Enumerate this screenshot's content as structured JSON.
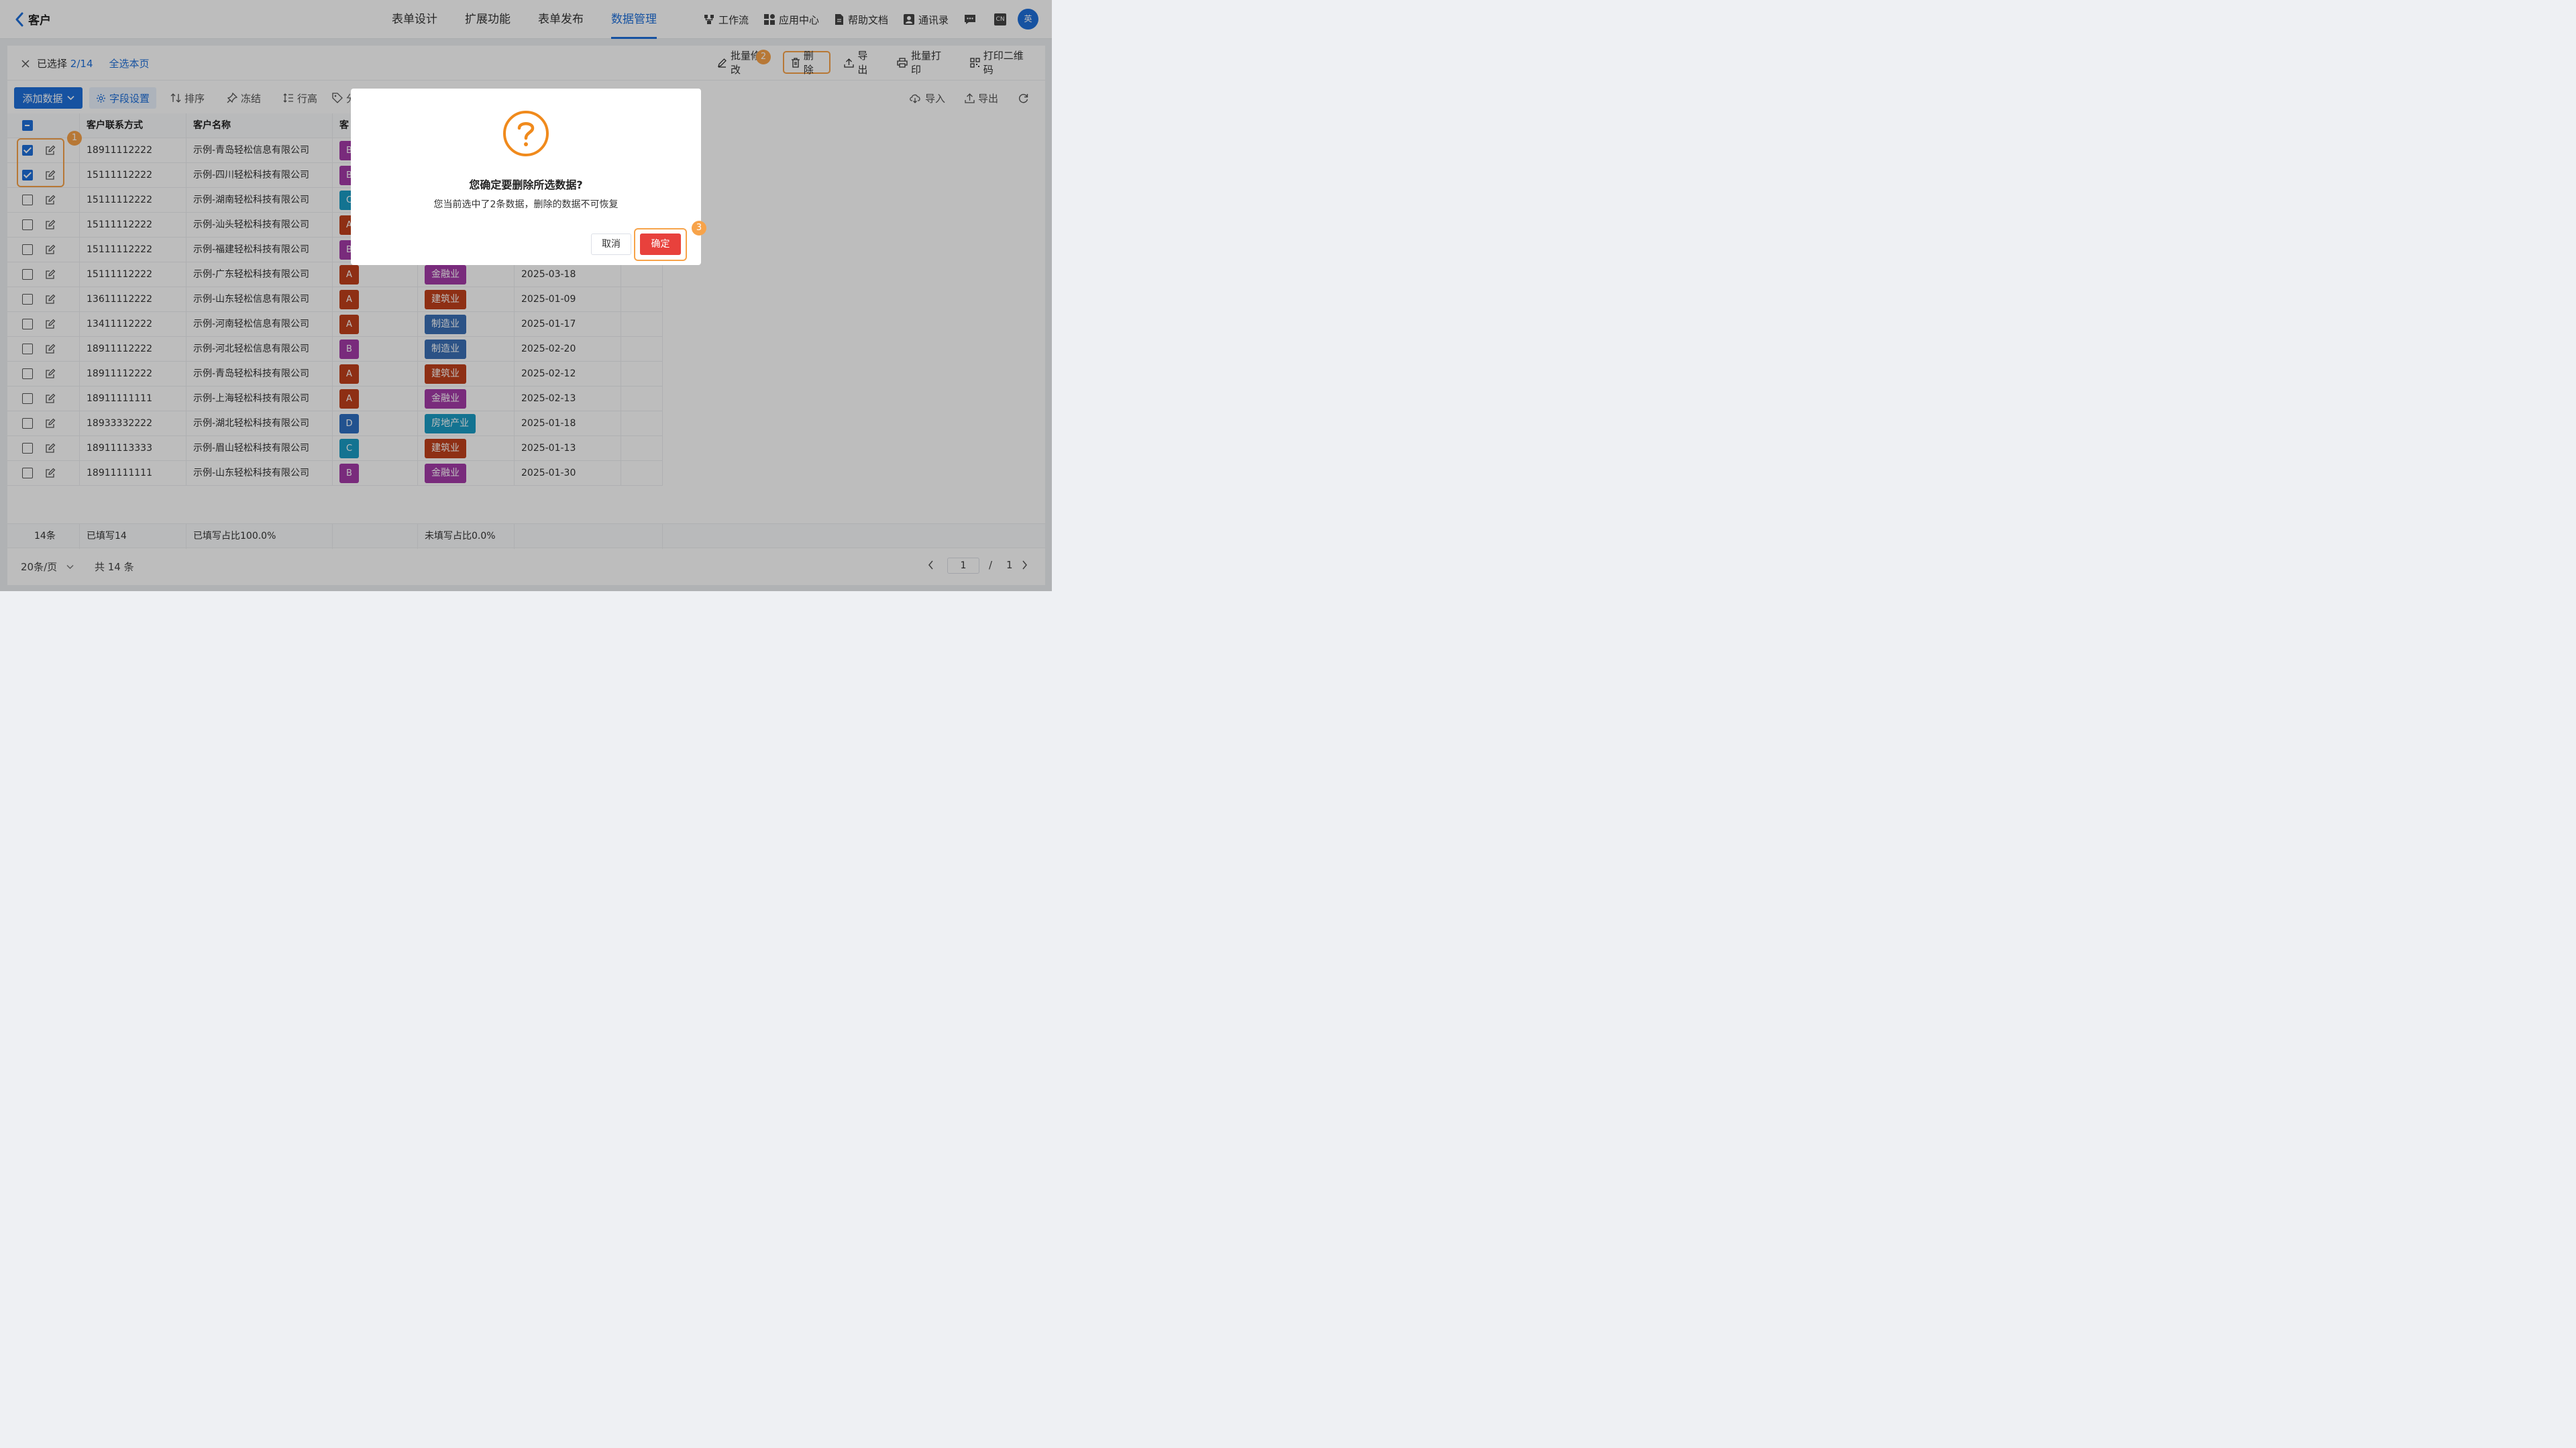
{
  "header": {
    "back_label": "客户",
    "tabs": [
      "表单设计",
      "扩展功能",
      "表单发布",
      "数据管理"
    ],
    "active_tab": "数据管理",
    "tools": [
      "工作流",
      "应用中心",
      "帮助文档",
      "通讯录"
    ],
    "lang_badge": "CN",
    "avatar": "英"
  },
  "selection": {
    "label": "已选择",
    "count": "2/14",
    "select_page": "全选本页",
    "actions": [
      "批量修改",
      "删除",
      "导出",
      "批量打印",
      "打印二维码"
    ]
  },
  "toolbar": {
    "add_label": "添加数据",
    "field_settings": "字段设置",
    "sort": "排序",
    "freeze": "冻结",
    "row_height": "行高",
    "tag_partial": "分",
    "import": "导入",
    "export": "导出"
  },
  "table": {
    "headers": [
      "客户联系方式",
      "客户名称",
      "客"
    ],
    "rows": [
      {
        "phone": "18911112222",
        "name": "示例-青岛轻松信息有限公司",
        "grade": "B",
        "industry": "",
        "date": "",
        "checked": true
      },
      {
        "phone": "15111112222",
        "name": "示例-四川轻松科技有限公司",
        "grade": "B",
        "industry": "",
        "date": "",
        "checked": true
      },
      {
        "phone": "15111112222",
        "name": "示例-湖南轻松科技有限公司",
        "grade": "C",
        "industry": "",
        "date": "",
        "checked": false
      },
      {
        "phone": "15111112222",
        "name": "示例-汕头轻松科技有限公司",
        "grade": "A",
        "industry": "",
        "date": "",
        "checked": false
      },
      {
        "phone": "15111112222",
        "name": "示例-福建轻松科技有限公司",
        "grade": "B",
        "industry": "",
        "date": "",
        "checked": false
      },
      {
        "phone": "15111112222",
        "name": "示例-广东轻松科技有限公司",
        "grade": "A",
        "industry": "金融业",
        "date": "2025-03-18",
        "checked": false
      },
      {
        "phone": "13611112222",
        "name": "示例-山东轻松信息有限公司",
        "grade": "A",
        "industry": "建筑业",
        "date": "2025-01-09",
        "checked": false
      },
      {
        "phone": "13411112222",
        "name": "示例-河南轻松信息有限公司",
        "grade": "A",
        "industry": "制造业",
        "date": "2025-01-17",
        "checked": false
      },
      {
        "phone": "18911112222",
        "name": "示例-河北轻松信息有限公司",
        "grade": "B",
        "industry": "制造业",
        "date": "2025-02-20",
        "checked": false
      },
      {
        "phone": "18911112222",
        "name": "示例-青岛轻松科技有限公司",
        "grade": "A",
        "industry": "建筑业",
        "date": "2025-02-12",
        "checked": false
      },
      {
        "phone": "18911111111",
        "name": "示例-上海轻松科技有限公司",
        "grade": "A",
        "industry": "金融业",
        "date": "2025-02-13",
        "checked": false
      },
      {
        "phone": "18933332222",
        "name": "示例-湖北轻松科技有限公司",
        "grade": "D",
        "industry": "房地产业",
        "date": "2025-01-18",
        "checked": false
      },
      {
        "phone": "18911113333",
        "name": "示例-眉山轻松科技有限公司",
        "grade": "C",
        "industry": "建筑业",
        "date": "2025-01-13",
        "checked": false
      },
      {
        "phone": "18911111111",
        "name": "示例-山东轻松科技有限公司",
        "grade": "B",
        "industry": "金融业",
        "date": "2025-01-30",
        "checked": false
      }
    ],
    "summary": [
      "14条",
      "已填写14",
      "已填写占比100.0%",
      "未填写占比0.0%"
    ]
  },
  "grade_colors": {
    "A": "#c0401c",
    "B": "#a43aa8",
    "C": "#1a9bc4",
    "D": "#2e6fc2"
  },
  "industry_colors": {
    "金融业": "#a43aa8",
    "建筑业": "#c0401c",
    "制造业": "#3a6fb5",
    "房地产业": "#1a9bc4"
  },
  "pagination": {
    "page_size": "20条/页",
    "total": "共 14 条",
    "current_page": "1",
    "separator": "/",
    "total_pages": "1"
  },
  "annotations": [
    "1",
    "2",
    "3"
  ],
  "dialog": {
    "title": "您确定要删除所选数据?",
    "message": "您当前选中了2条数据，删除的数据不可恢复",
    "cancel_label": "取消",
    "confirm_label": "确定"
  }
}
